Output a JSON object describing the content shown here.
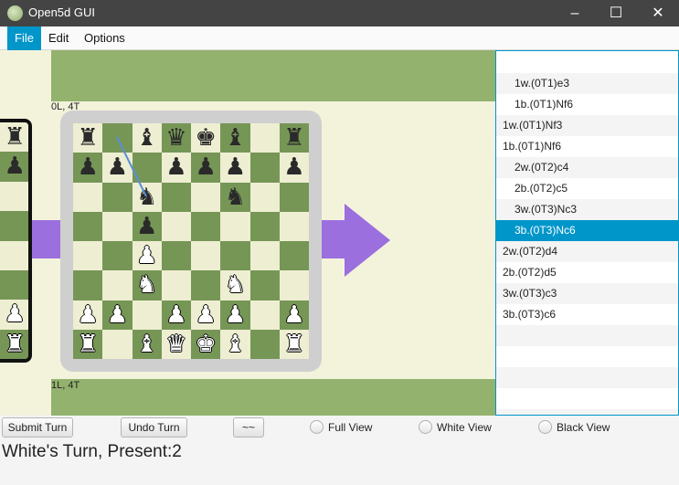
{
  "window": {
    "title": "Open5d GUI",
    "controls": {
      "minimize": "–",
      "maximize": "☐",
      "close": "✕"
    }
  },
  "menubar": {
    "items": [
      "File",
      "Edit",
      "Options"
    ],
    "active": "File"
  },
  "board_area": {
    "timeline_labels": {
      "top": "0L, 4T",
      "bottom": "1L, 4T"
    },
    "colors": {
      "light_square": "#eeeed2",
      "dark_square": "#769656",
      "background": "#f3f3dc",
      "band": "#93b26e",
      "arrow": "#9b6fde",
      "move_line": "#5b8fd6"
    },
    "main_board": {
      "ranks": [
        [
          "b-rook",
          "",
          "b-bishop",
          "b-queen",
          "b-king",
          "b-bishop",
          "",
          "b-rook"
        ],
        [
          "b-pawn",
          "b-pawn",
          "",
          "b-pawn",
          "b-pawn",
          "b-pawn",
          "",
          "b-pawn"
        ],
        [
          "",
          "",
          "b-knight",
          "",
          "",
          "b-knight",
          "",
          ""
        ],
        [
          "",
          "",
          "b-pawn",
          "",
          "",
          "",
          "",
          ""
        ],
        [
          "",
          "",
          "w-pawn",
          "",
          "",
          "",
          "",
          ""
        ],
        [
          "",
          "",
          "w-knight",
          "",
          "",
          "w-knight",
          "",
          ""
        ],
        [
          "w-pawn",
          "w-pawn",
          "",
          "w-pawn",
          "w-pawn",
          "w-pawn",
          "",
          "w-pawn"
        ],
        [
          "w-rook",
          "",
          "w-bishop",
          "w-queen",
          "w-king",
          "w-bishop",
          "",
          "w-rook"
        ]
      ]
    },
    "left_board_visible_file": [
      "b-rook",
      "b-pawn",
      "",
      "",
      "",
      "",
      "w-pawn",
      "w-rook"
    ],
    "piece_glyphs": {
      "b-rook": "♜",
      "b-knight": "♞",
      "b-bishop": "♝",
      "b-queen": "♛",
      "b-king": "♚",
      "b-pawn": "♟",
      "w-rook": "♜",
      "w-knight": "♞",
      "w-bishop": "♝",
      "w-queen": "♛",
      "w-king": "♚",
      "w-pawn": "♟"
    }
  },
  "move_list": {
    "items": [
      {
        "text": "",
        "indented": false
      },
      {
        "text": "1w.(0T1)e3",
        "indented": true
      },
      {
        "text": "1b.(0T1)Nf6",
        "indented": true
      },
      {
        "text": "1w.(0T1)Nf3",
        "indented": false
      },
      {
        "text": "1b.(0T1)Nf6",
        "indented": false
      },
      {
        "text": "2w.(0T2)c4",
        "indented": true
      },
      {
        "text": "2b.(0T2)c5",
        "indented": true
      },
      {
        "text": "3w.(0T3)Nc3",
        "indented": true
      },
      {
        "text": "3b.(0T3)Nc6",
        "indented": true,
        "selected": true
      },
      {
        "text": "2w.(0T2)d4",
        "indented": false
      },
      {
        "text": "2b.(0T2)d5",
        "indented": false
      },
      {
        "text": "3w.(0T3)c3",
        "indented": false
      },
      {
        "text": "3b.(0T3)c6",
        "indented": false
      }
    ]
  },
  "controls": {
    "submit_turn": "Submit Turn",
    "undo_turn": "Undo Turn",
    "swap": "~~",
    "views": [
      "Full View",
      "White View",
      "Black View"
    ]
  },
  "status": "White's Turn,  Present:2"
}
